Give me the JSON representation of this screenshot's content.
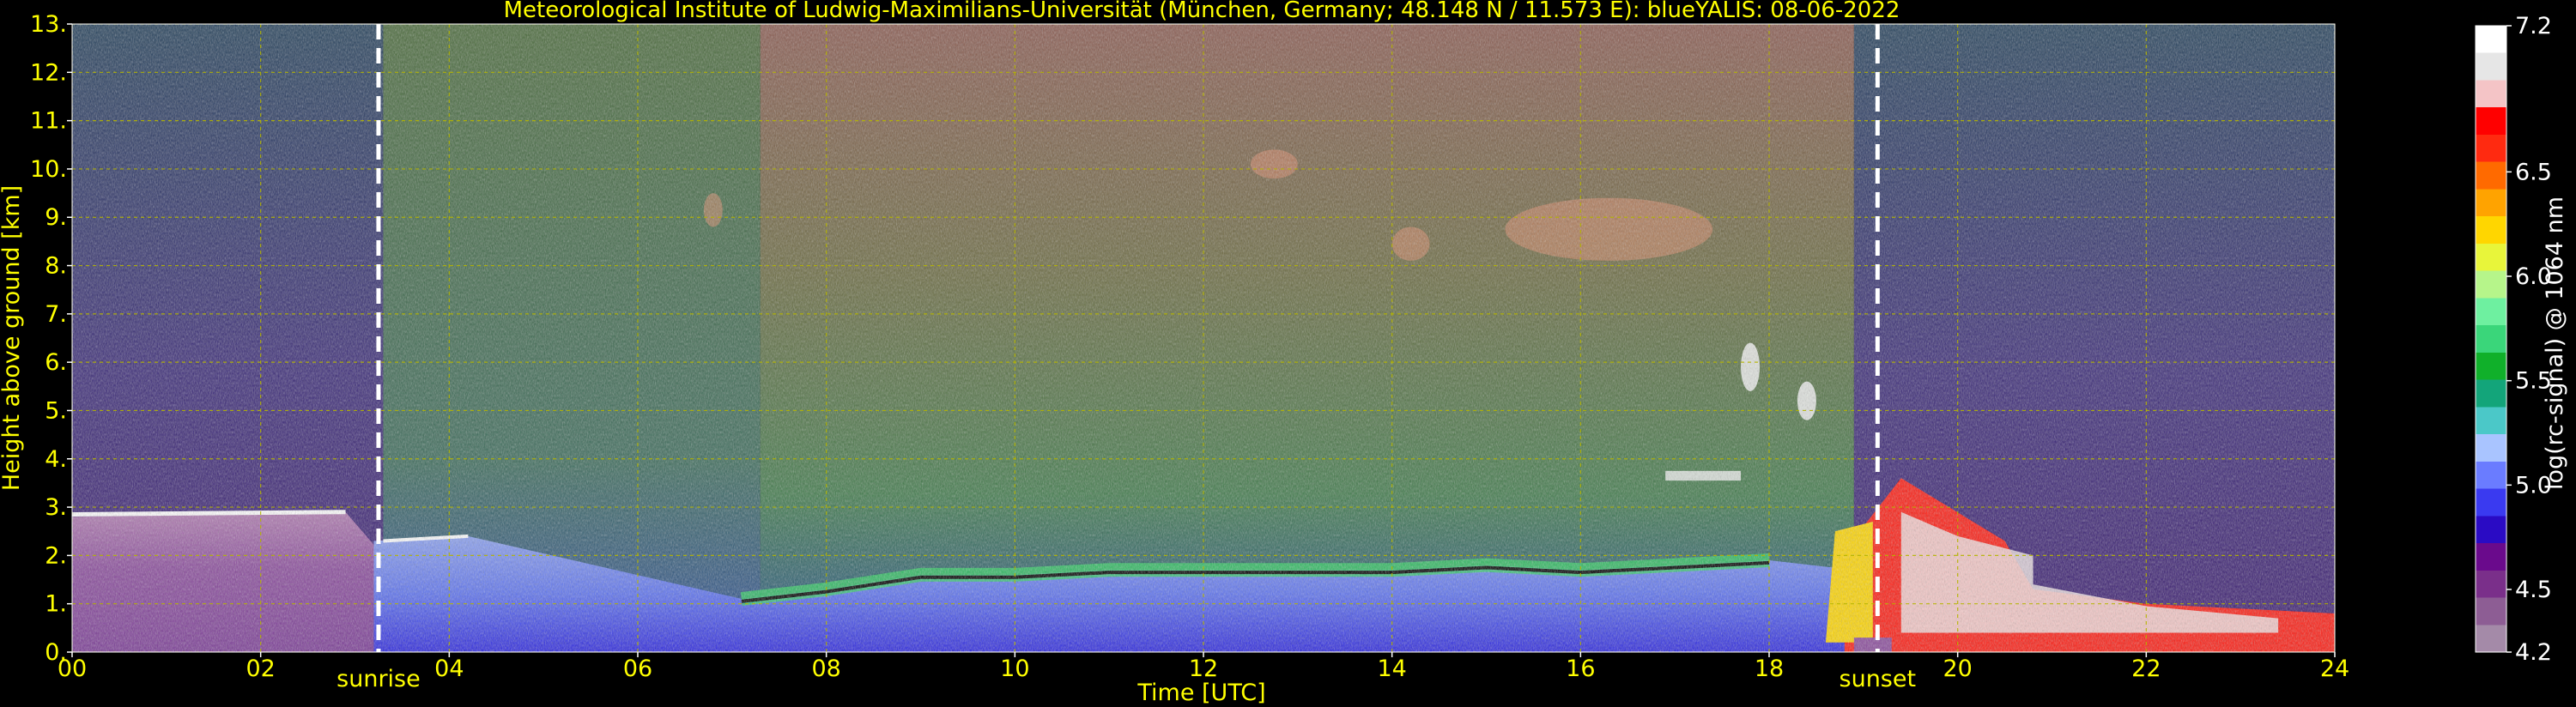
{
  "page": {
    "background": "#000000"
  },
  "colors": {
    "text": "#ffff00",
    "grid": "#b5b500",
    "marker": "#ffffff",
    "cbar_text": "#ffffff",
    "colormap": [
      "#a48aa8",
      "#8d5d94",
      "#7a2f8a",
      "#6a0a8c",
      "#2a0bc4",
      "#3a3af0",
      "#6a7cff",
      "#a9c4ff",
      "#4bc8c8",
      "#13a57a",
      "#10b02a",
      "#3ad67a",
      "#6ef0a0",
      "#b6f58a",
      "#e8f53a",
      "#ffd600",
      "#ffa300",
      "#ff6a00",
      "#ff2a10",
      "#ff0000",
      "#f4c4c6",
      "#e6e6e6",
      "#ffffff"
    ]
  },
  "chart_data": {
    "type": "heatmap",
    "title": "Meteorological Institute of Ludwig-Maximilians-Universität (München, Germany; 48.148 N / 11.573 E):    blueYALIS: 08-06-2022",
    "xlabel": "Time [UTC]",
    "ylabel": "Height above ground [km]",
    "xlim": [
      0,
      24
    ],
    "ylim": [
      0,
      13
    ],
    "x_ticks": [
      "00",
      "02",
      "04",
      "06",
      "08",
      "10",
      "12",
      "14",
      "16",
      "18",
      "20",
      "22",
      "24"
    ],
    "x_tick_values": [
      0,
      2,
      4,
      6,
      8,
      10,
      12,
      14,
      16,
      18,
      20,
      22,
      24
    ],
    "y_ticks": [
      "0.",
      "1.",
      "2.",
      "3.",
      "4.",
      "5.",
      "6.",
      "7.",
      "8.",
      "9.",
      "10.",
      "11.",
      "12.",
      "13."
    ],
    "y_tick_values": [
      0,
      1,
      2,
      3,
      4,
      5,
      6,
      7,
      8,
      9,
      10,
      11,
      12,
      13
    ],
    "grid": true,
    "vertical_markers": [
      {
        "label": "sunrise",
        "x": 3.25
      },
      {
        "label": "sunset",
        "x": 19.15
      }
    ],
    "colorbar": {
      "label": "log(rc-signal) @ 1064 nm",
      "range": [
        4.2,
        7.2
      ],
      "ticks": [
        "4.2",
        "4.5",
        "5.0",
        "5.5",
        "6.0",
        "6.5",
        "7.2"
      ],
      "tick_values": [
        4.2,
        4.5,
        5.0,
        5.5,
        6.0,
        6.5,
        7.2
      ]
    },
    "features": {
      "residual_layer_top_km": [
        {
          "x": 0.0,
          "y": 2.8
        },
        {
          "x": 2.9,
          "y": 2.9
        }
      ],
      "boundary_layer_top_km": [
        {
          "x": 3.2,
          "y": 2.3
        },
        {
          "x": 4.2,
          "y": 2.4
        },
        {
          "x": 7.1,
          "y": 1.1
        },
        {
          "x": 8.0,
          "y": 1.3
        },
        {
          "x": 9.0,
          "y": 1.6
        },
        {
          "x": 10.0,
          "y": 1.6
        },
        {
          "x": 11.0,
          "y": 1.7
        },
        {
          "x": 12.0,
          "y": 1.7
        },
        {
          "x": 13.0,
          "y": 1.7
        },
        {
          "x": 14.0,
          "y": 1.7
        },
        {
          "x": 15.0,
          "y": 1.8
        },
        {
          "x": 16.0,
          "y": 1.7
        },
        {
          "x": 17.0,
          "y": 1.8
        },
        {
          "x": 18.0,
          "y": 1.9
        }
      ],
      "cirrus_patches": [
        {
          "x": [
            6.7,
            6.9
          ],
          "y": [
            8.8,
            9.5
          ]
        },
        {
          "x": [
            12.5,
            13.0
          ],
          "y": [
            9.8,
            10.4
          ]
        },
        {
          "x": [
            14.0,
            14.4
          ],
          "y": [
            8.1,
            8.8
          ]
        },
        {
          "x": [
            15.2,
            17.4
          ],
          "y": [
            8.1,
            9.4
          ]
        },
        {
          "x": [
            17.7,
            17.9
          ],
          "y": [
            5.4,
            6.4
          ]
        },
        {
          "x": [
            18.3,
            18.5
          ],
          "y": [
            4.8,
            5.6
          ]
        }
      ],
      "evening_aerosol_layer": [
        {
          "x": 19.4,
          "y": 3.6
        },
        {
          "x": 20.5,
          "y": 2.3
        },
        {
          "x": 24.0,
          "y": 0.8
        }
      ]
    }
  }
}
